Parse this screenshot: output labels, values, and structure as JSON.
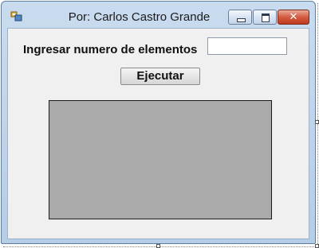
{
  "window": {
    "title": "Por: Carlos Castro Grande",
    "close_glyph": "✕",
    "icons": {
      "app": "app-form-icon",
      "minimize": "minimize-icon",
      "maximize": "maximize-icon",
      "close": "close-icon"
    }
  },
  "form": {
    "prompt_label": "Ingresar numero de elementos",
    "elements_input_value": "",
    "run_button_label": "Ejecutar"
  },
  "colors": {
    "panel_fill": "#aaaaaa",
    "client_background": "#f0f0f0",
    "title_bar": "#c9dbef",
    "close_button": "#c0391d"
  }
}
